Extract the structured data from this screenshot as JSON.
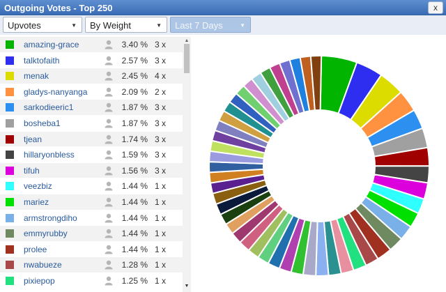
{
  "window": {
    "title": "Outgoing Votes - Top 250",
    "close_label": "x"
  },
  "filters": {
    "type": {
      "selected": "Upvotes"
    },
    "sort": {
      "selected": "By Weight"
    },
    "period": {
      "selected": "Last 7 Days",
      "disabled": true
    }
  },
  "voters": [
    {
      "name": "amazing-grace",
      "percent": "3.40 %",
      "count": "3 x",
      "color": "#00b400"
    },
    {
      "name": "talktofaith",
      "percent": "2.57 %",
      "count": "3 x",
      "color": "#2e2ef0"
    },
    {
      "name": "menak",
      "percent": "2.45 %",
      "count": "4 x",
      "color": "#dcdc00"
    },
    {
      "name": "gladys-nanyanga",
      "percent": "2.09 %",
      "count": "2 x",
      "color": "#ff9240"
    },
    {
      "name": "sarkodieeric1",
      "percent": "1.87 %",
      "count": "3 x",
      "color": "#2d8ff0"
    },
    {
      "name": "bosheba1",
      "percent": "1.87 %",
      "count": "3 x",
      "color": "#a0a0a0"
    },
    {
      "name": "tjean",
      "percent": "1.74 %",
      "count": "3 x",
      "color": "#a00000"
    },
    {
      "name": "hillaryonbless",
      "percent": "1.59 %",
      "count": "3 x",
      "color": "#444444"
    },
    {
      "name": "tifuh",
      "percent": "1.56 %",
      "count": "3 x",
      "color": "#dc00dc"
    },
    {
      "name": "veezbiz",
      "percent": "1.44 %",
      "count": "1 x",
      "color": "#30ffff"
    },
    {
      "name": "mariez",
      "percent": "1.44 %",
      "count": "1 x",
      "color": "#00e000"
    },
    {
      "name": "armstrongdiho",
      "percent": "1.44 %",
      "count": "1 x",
      "color": "#7ab0e8"
    },
    {
      "name": "emmyrubby",
      "percent": "1.44 %",
      "count": "1 x",
      "color": "#6f8a60"
    },
    {
      "name": "prolee",
      "percent": "1.44 %",
      "count": "1 x",
      "color": "#a03020"
    },
    {
      "name": "nwabueze",
      "percent": "1.28 %",
      "count": "1 x",
      "color": "#a84848"
    },
    {
      "name": "pixiepop",
      "percent": "1.25 %",
      "count": "1 x",
      "color": "#20e080"
    }
  ],
  "chart_data": {
    "type": "pie",
    "donut": true,
    "labels": [
      "amazing-grace",
      "talktofaith",
      "menak",
      "gladys-nanyanga",
      "sarkodieeric1",
      "bosheba1",
      "tjean",
      "hillaryonbless",
      "tifuh",
      "veezbiz",
      "mariez",
      "armstrongdiho",
      "emmyrubby",
      "prolee",
      "nwabueze",
      "pixiepop"
    ],
    "values": [
      3.4,
      2.57,
      2.45,
      2.09,
      1.87,
      1.87,
      1.74,
      1.59,
      1.56,
      1.44,
      1.44,
      1.44,
      1.44,
      1.44,
      1.28,
      1.25
    ],
    "colors": [
      "#00b400",
      "#2e2ef0",
      "#dcdc00",
      "#ff9240",
      "#2d8ff0",
      "#a0a0a0",
      "#a00000",
      "#444444",
      "#dc00dc",
      "#30ffff",
      "#00e000",
      "#7ab0e8",
      "#6f8a60",
      "#a03020",
      "#a84848",
      "#20e080"
    ],
    "unlisted_values": [
      1.2,
      1.2,
      1.2,
      1.2,
      1.15,
      1.15,
      1.15,
      1.1,
      1.1,
      1.1,
      1.1,
      1.05,
      1.05,
      1.05,
      1.05,
      1.0,
      1.0,
      1.0,
      1.0,
      1.0,
      1.0,
      1.0,
      1.0,
      1.0,
      1.0,
      1.0,
      1.0,
      1.0,
      1.0,
      1.0,
      1.0,
      1.0,
      1.0,
      1.0
    ],
    "unlisted_colors": [
      "#e88fa0",
      "#2a9090",
      "#8ab0f0",
      "#a8a8c8",
      "#30c030",
      "#b040b0",
      "#2070b0",
      "#60d080",
      "#a0c060",
      "#d06080",
      "#a03870",
      "#e0a060",
      "#1a4010",
      "#0a1a3a",
      "#8a6010",
      "#5a2090",
      "#d08020",
      "#3060a0",
      "#9a9ae0",
      "#c0e060",
      "#7040a0",
      "#8080c0",
      "#d0a040",
      "#209090",
      "#3060c0",
      "#70d070",
      "#d090d0",
      "#a0d0e0",
      "#40a040",
      "#c04090",
      "#7070d0",
      "#2080e0",
      "#c06020",
      "#804010"
    ]
  }
}
